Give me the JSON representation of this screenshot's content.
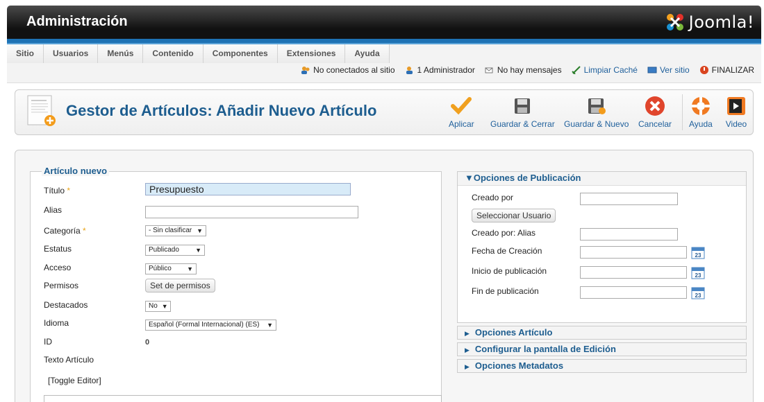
{
  "header": {
    "title": "Administración",
    "logo_text": "Joomla!"
  },
  "menu": [
    "Sitio",
    "Usuarios",
    "Menús",
    "Contenido",
    "Componentes",
    "Extensiones",
    "Ayuda"
  ],
  "status": {
    "not_connected": "No conectados al sitio",
    "admins": "1 Administrador",
    "messages": "No hay mensajes",
    "clear_cache": "Limpiar Caché",
    "view_site": "Ver sitio",
    "logout": "FINALIZAR"
  },
  "toolbar": {
    "page_title": "Gestor de Artículos: Añadir Nuevo Artículo",
    "apply": "Aplicar",
    "save_close": "Guardar & Cerrar",
    "save_new": "Guardar & Nuevo",
    "cancel": "Cancelar",
    "help": "Ayuda",
    "video": "Video"
  },
  "form": {
    "legend": "Artículo nuevo",
    "title_label": "Título",
    "title_value": "Presupuesto",
    "alias_label": "Alias",
    "alias_value": "",
    "category_label": "Categoría",
    "category_value": "- Sin clasificar",
    "status_label": "Estatus",
    "status_value": "Publicado",
    "access_label": "Acceso",
    "access_value": "Público",
    "permissions_label": "Permisos",
    "permissions_button": "Set de permisos",
    "featured_label": "Destacados",
    "featured_value": "No",
    "language_label": "Idioma",
    "language_value": "Español (Formal Internacional) (ES)",
    "id_label": "ID",
    "id_value": "0",
    "text_label": "Texto Artículo",
    "toggle_editor": "[Toggle Editor]",
    "required_mark": "*"
  },
  "publishing": {
    "header": "Opciones de Publicación",
    "created_by": "Creado por",
    "select_user": "Seleccionar Usuario",
    "created_by_alias": "Creado por: Alias",
    "created_date": "Fecha de Creación",
    "publish_up": "Inicio de publicación",
    "publish_down": "Fin de publicación",
    "calendar_day": "23"
  },
  "panels": [
    "Opciones Artículo",
    "Configurar la pantalla de Edición",
    "Opciones Metadatos"
  ]
}
